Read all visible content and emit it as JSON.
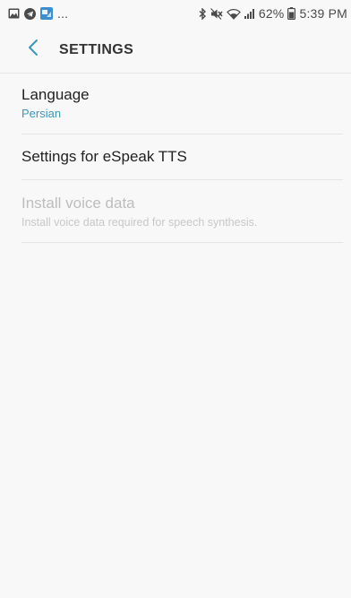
{
  "status_bar": {
    "left_icons": [
      "image-icon",
      "telegram-icon",
      "app-notification-icon"
    ],
    "more_indicator": "...",
    "right_icons": [
      "bluetooth-icon",
      "mute-icon",
      "wifi-icon",
      "signal-icon",
      "battery-icon"
    ],
    "battery_percent": "62%",
    "time": "5:39 PM"
  },
  "app_bar": {
    "title": "SETTINGS",
    "back_icon": "chevron-left-icon"
  },
  "colors": {
    "accent": "#3a97b8",
    "background": "#f8f8f8",
    "disabled_text": "#bdbdbd"
  },
  "settings": {
    "language": {
      "title": "Language",
      "summary": "Persian"
    },
    "espeak": {
      "title": "Settings for eSpeak TTS"
    },
    "install_voice": {
      "title": "Install voice data",
      "summary": "Install voice data required for speech synthesis.",
      "enabled": false
    }
  }
}
